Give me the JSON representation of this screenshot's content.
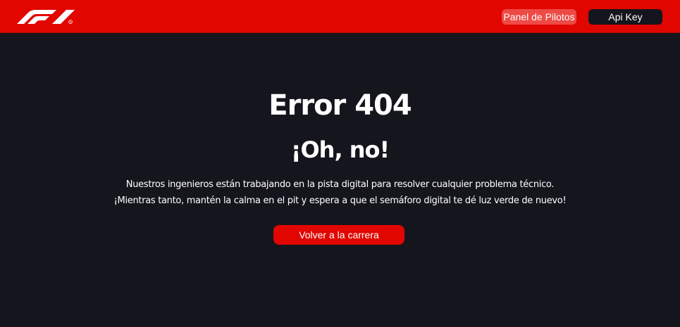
{
  "brand": {
    "logo_icon": "f1-logo-icon",
    "accent_color": "#e10600",
    "background_color": "#15151e"
  },
  "nav": {
    "pilots_label": "Panel de Pilotos",
    "apikey_label": "Api Key"
  },
  "error": {
    "title": "Error 404",
    "subtitle": "¡Oh, no!",
    "line1": "Nuestros ingenieros están trabajando en la pista digital para resolver cualquier problema técnico.",
    "line2": "¡Mientras tanto, mantén la calma en el pit y espera a que el semáforo digital te dé luz verde de nuevo!",
    "back_label": "Volver a la carrera"
  }
}
